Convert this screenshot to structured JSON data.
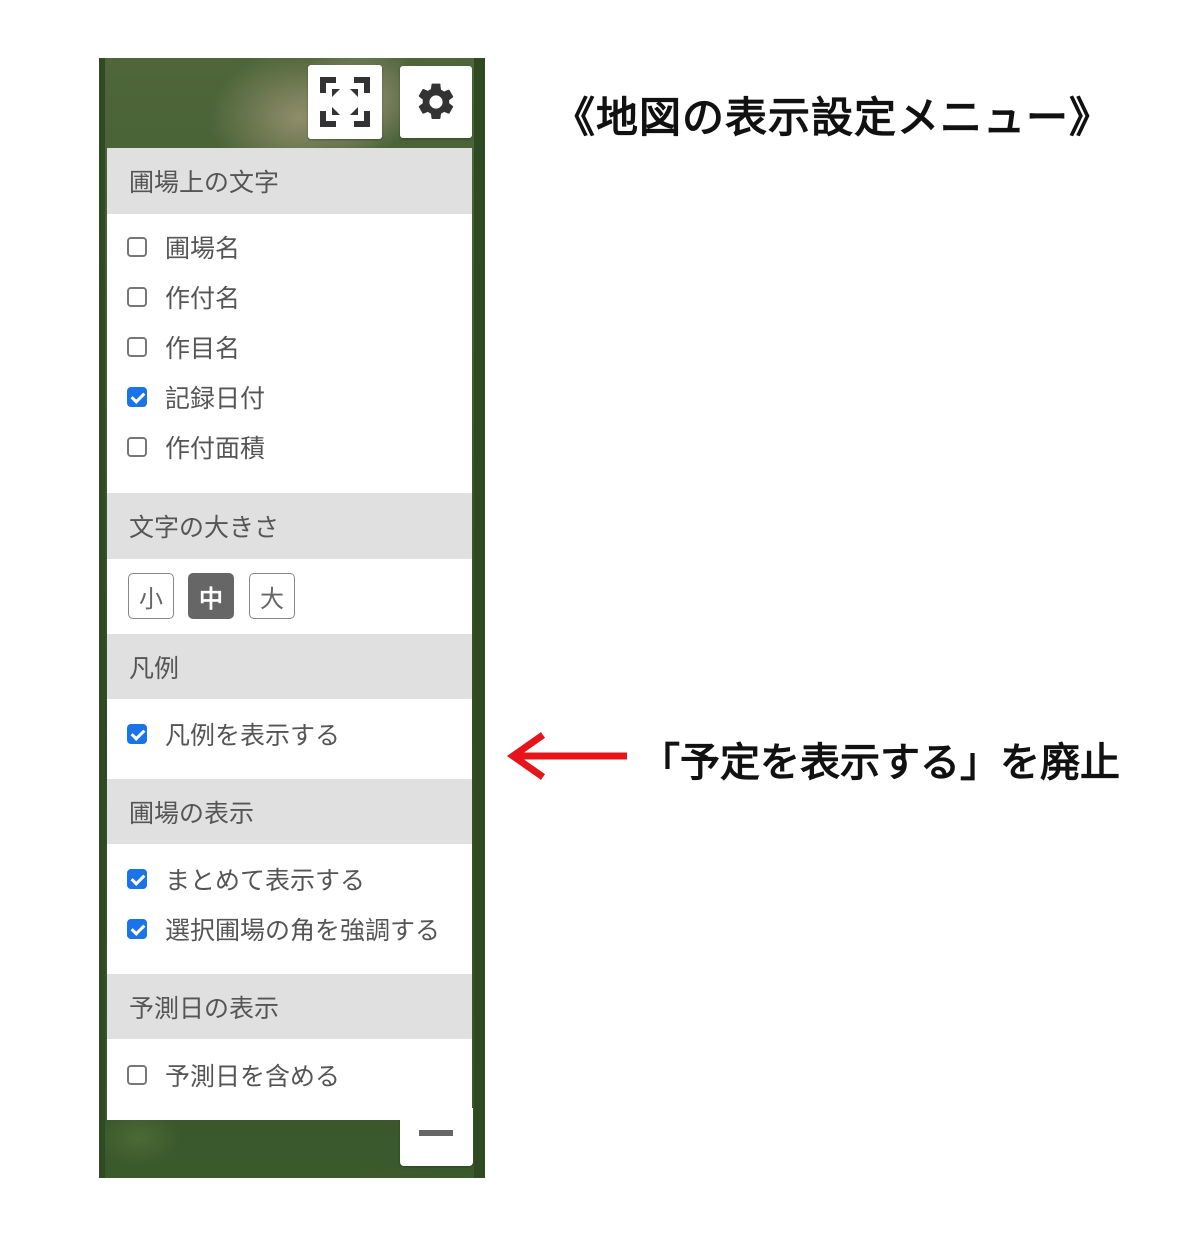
{
  "title": "《地図の表示設定メニュー》",
  "annotation": {
    "text": "「予定を表示する」を廃止",
    "arrow_color": "#e8141c"
  },
  "map_controls": {
    "fullscreen_icon": "expand-icon",
    "settings_icon": "gear-icon",
    "zoom_out_icon": "minus-icon"
  },
  "panel": {
    "field_text": {
      "header": "圃場上の文字",
      "items": [
        {
          "label": "圃場名",
          "checked": false
        },
        {
          "label": "作付名",
          "checked": false
        },
        {
          "label": "作目名",
          "checked": false
        },
        {
          "label": "記録日付",
          "checked": true
        },
        {
          "label": "作付面積",
          "checked": false
        }
      ]
    },
    "text_size": {
      "header": "文字の大きさ",
      "options": [
        "小",
        "中",
        "大"
      ],
      "selected": "中"
    },
    "legend": {
      "header": "凡例",
      "items": [
        {
          "label": "凡例を表示する",
          "checked": true
        }
      ]
    },
    "field_display": {
      "header": "圃場の表示",
      "items": [
        {
          "label": "まとめて表示する",
          "checked": true
        },
        {
          "label": "選択圃場の角を強調する",
          "checked": true
        }
      ]
    },
    "forecast": {
      "header": "予測日の表示",
      "items": [
        {
          "label": "予測日を含める",
          "checked": false
        }
      ]
    }
  },
  "colors": {
    "checkbox_checked": "#1a73e8",
    "section_header_bg": "#e0e0e0",
    "size_active_bg": "#666666"
  }
}
